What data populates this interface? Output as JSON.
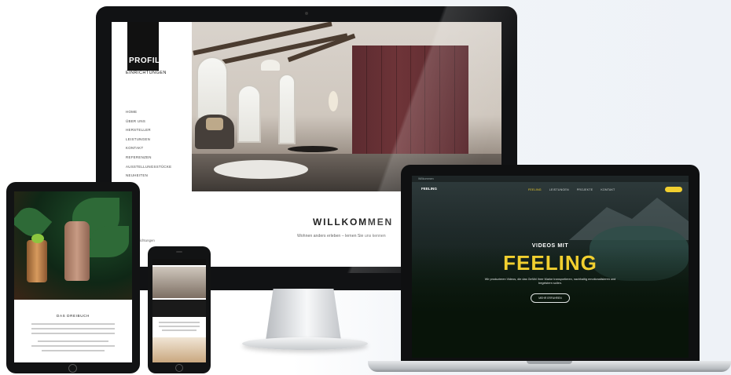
{
  "desktop": {
    "logo": {
      "name": "PROFIL",
      "sub": "EINRICHTUNGEN"
    },
    "nav_items": [
      "HOME",
      "ÜBER UNS",
      "HERSTELLER",
      "LEISTUNGEN",
      "KONTAKT",
      "REFERENZEN",
      "AUSSTELLUNGSSTÜCKE",
      "NEUHEITEN"
    ],
    "footer_text": "Einrichtungen",
    "hero": {
      "heading": "WILLKOMMEN",
      "subheading": "Wohnen anders erleben – lernen Sie uns kennen"
    }
  },
  "tablet": {
    "section_title": "DAS DREIBUCH"
  },
  "laptop": {
    "topbar_info": "Willkommen",
    "logo": "FEELING",
    "nav_items": [
      "FEELING",
      "LEISTUNGEN",
      "PROJEKTE",
      "KONTAKT"
    ],
    "hero": {
      "pretitle": "VIDEOS MIT",
      "title": "FEELING",
      "text": "Wir produzieren Videos, die das Gefühl Ihrer Marke transportieren, nachhaltig emotionalisieren und begeistern sollen.",
      "cta": "MEHR ERFAHREN"
    }
  },
  "colors": {
    "accent_yellow": "#f1cf2f",
    "wardrobe": "#6e3438",
    "device_black": "#111214"
  }
}
